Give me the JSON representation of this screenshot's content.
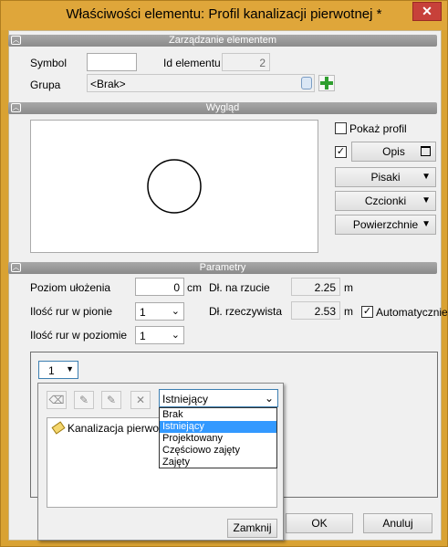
{
  "window": {
    "title": "Właściwości elementu: Profil kanalizacji pierwotnej *",
    "close_glyph": "✕"
  },
  "sections": {
    "management": "Zarządzanie elementem",
    "appearance": "Wygląd",
    "parameters": "Parametry"
  },
  "management": {
    "symbol_label": "Symbol",
    "symbol_value": "",
    "id_label": "Id elementu",
    "id_value": "2",
    "group_label": "Grupa",
    "group_value": "<Brak>"
  },
  "appearance": {
    "show_profile_label": "Pokaż profil",
    "show_profile_checked": false,
    "description_checked": true,
    "description_button": "Opis",
    "pens_button": "Pisaki",
    "fonts_button": "Czcionki",
    "surfaces_button": "Powierzchnie"
  },
  "parameters": {
    "level_label": "Poziom ułożenia",
    "level_value": "0",
    "level_unit": "cm",
    "vertical_pipes_label": "Ilość rur w pionie",
    "vertical_pipes_value": "1",
    "horizontal_pipes_label": "Ilość rur w poziomie",
    "horizontal_pipes_value": "1",
    "projection_length_label": "Dł. na rzucie",
    "projection_length_value": "2.25",
    "projection_length_unit": "m",
    "real_length_label": "Dł. rzeczywista",
    "real_length_value": "2.53",
    "real_length_unit": "m",
    "automatic_label": "Automatycznie",
    "automatic_checked": true
  },
  "pipe_selector": {
    "value": "1"
  },
  "popup": {
    "status_value": "Istniejący",
    "tree_item": "Kanalizacja pierwotna",
    "close_button": "Zamknij"
  },
  "status_options": [
    "Brak",
    "Istniejący",
    "Projektowany",
    "Częściowo zajęty",
    "Zajęty"
  ],
  "status_selected_index": 1,
  "footer": {
    "ok_button": "OK",
    "cancel_button": "Anuluj"
  },
  "colors": {
    "window_frame": "#d9a233",
    "close_button": "#c7413a",
    "selection": "#3399ff",
    "add_icon": "#2e9e2e"
  },
  "icons": [
    "close-icon",
    "chevron-up-icon",
    "dropdown-arrow-icon",
    "picker-icon",
    "add-icon",
    "eraser-icon",
    "pencil-icon",
    "delete-icon",
    "pipe-icon",
    "window-icon"
  ]
}
